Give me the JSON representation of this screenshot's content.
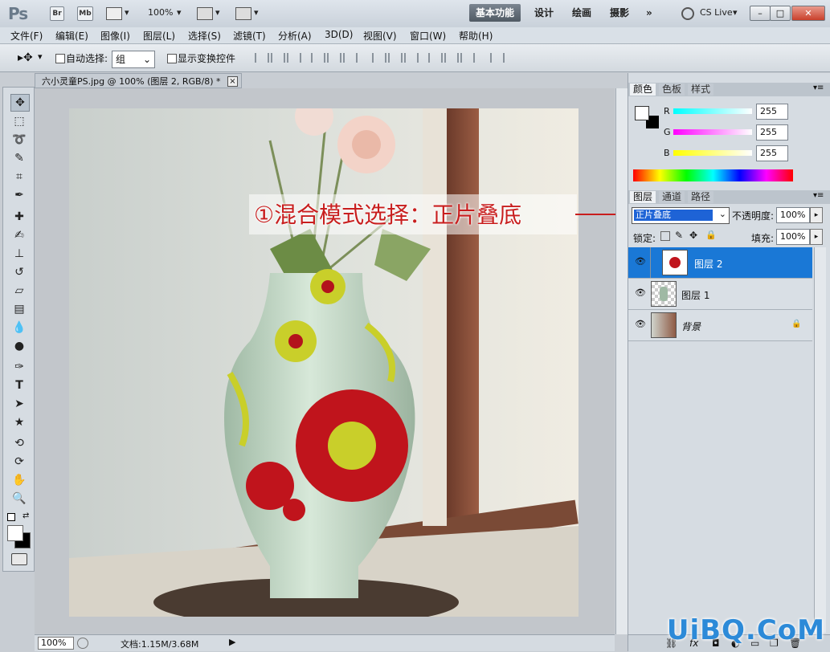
{
  "appbar": {
    "logo": "Ps",
    "bridge_label": "Br",
    "minibridge_label": "Mb",
    "zoom": "100%",
    "workspaces": [
      "基本功能",
      "设计",
      "绘画",
      "摄影"
    ],
    "more_label": "»",
    "cs_live": "CS Live",
    "window_controls": [
      "–",
      "□",
      "✕"
    ]
  },
  "menu": [
    "文件(F)",
    "编辑(E)",
    "图像(I)",
    "图层(L)",
    "选择(S)",
    "滤镜(T)",
    "分析(A)",
    "3D(D)",
    "视图(V)",
    "窗口(W)",
    "帮助(H)"
  ],
  "options": {
    "auto_select_label": "自动选择:",
    "auto_select_value": "组",
    "show_transform_label": "显示变换控件"
  },
  "document": {
    "tab_title": "六小灵童PS.jpg @ 100% (图层 2, RGB/8) *",
    "close": "×",
    "status_zoom": "100%",
    "status_doc": "文档:1.15M/3.68M"
  },
  "color_panel": {
    "tabs": [
      "颜色",
      "色板",
      "样式"
    ],
    "channels": [
      {
        "label": "R",
        "value": "255",
        "color": "#00e0e0"
      },
      {
        "label": "G",
        "value": "255",
        "color": "#e000e0"
      },
      {
        "label": "B",
        "value": "255",
        "color": "#e0e000"
      }
    ]
  },
  "layers_panel": {
    "tabs": [
      "图层",
      "通道",
      "路径"
    ],
    "blend_mode": "正片叠底",
    "opacity_label": "不透明度:",
    "opacity_value": "100%",
    "lock_label": "锁定:",
    "fill_label": "填充:",
    "fill_value": "100%",
    "layers": [
      {
        "name": "图层 2",
        "selected": true
      },
      {
        "name": "图层 1",
        "selected": false
      },
      {
        "name": "背景",
        "selected": false,
        "locked": true
      }
    ]
  },
  "annotation": "①混合模式选择：正片叠底",
  "watermark": "UiBQ.CoM"
}
